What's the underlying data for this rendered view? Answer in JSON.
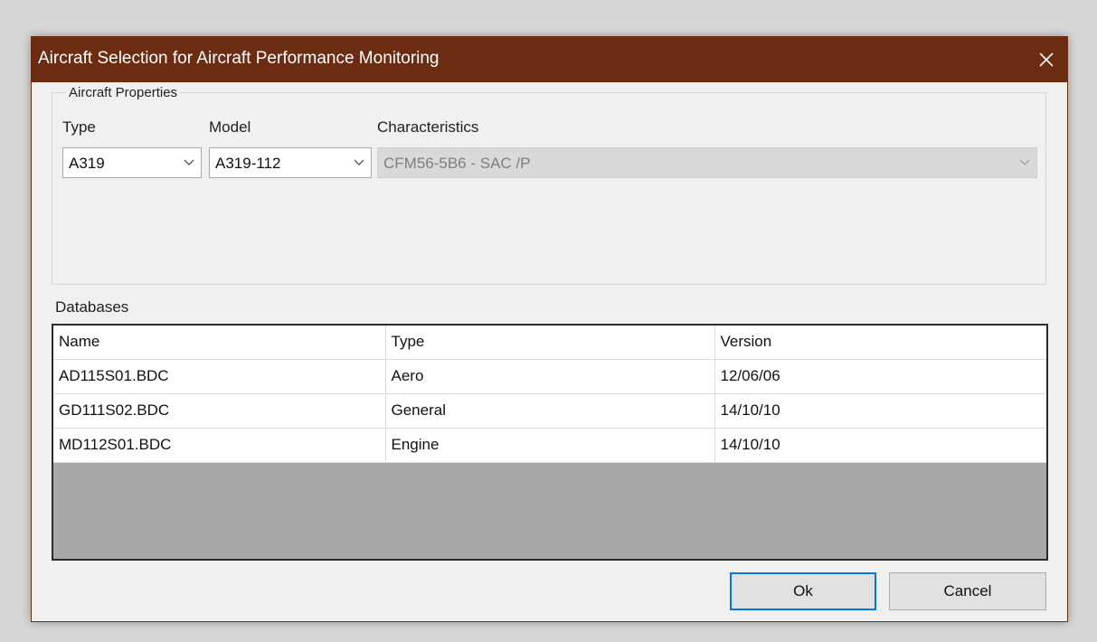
{
  "window": {
    "title": "Aircraft Selection for Aircraft Performance Monitoring",
    "close_icon": "close-icon"
  },
  "aircraft_properties": {
    "group_label": "Aircraft Properties",
    "type_label": "Type",
    "type_value": "A319",
    "model_label": "Model",
    "model_value": "A319-112",
    "characteristics_label": "Characteristics",
    "characteristics_value": "CFM56-5B6 -  SAC /P"
  },
  "databases": {
    "label": "Databases",
    "columns": [
      "Name",
      "Type",
      "Version"
    ],
    "rows": [
      [
        "AD115S01.BDC",
        "Aero",
        "12/06/06"
      ],
      [
        "GD111S02.BDC",
        "General",
        "14/10/10"
      ],
      [
        "MD112S01.BDC",
        "Engine",
        "14/10/10"
      ]
    ]
  },
  "buttons": {
    "ok_label": "Ok",
    "cancel_label": "Cancel"
  },
  "colors": {
    "titlebar": "#6b2c12",
    "default_button_border": "#0078d7",
    "grid_empty_area": "#a8a8a8"
  }
}
